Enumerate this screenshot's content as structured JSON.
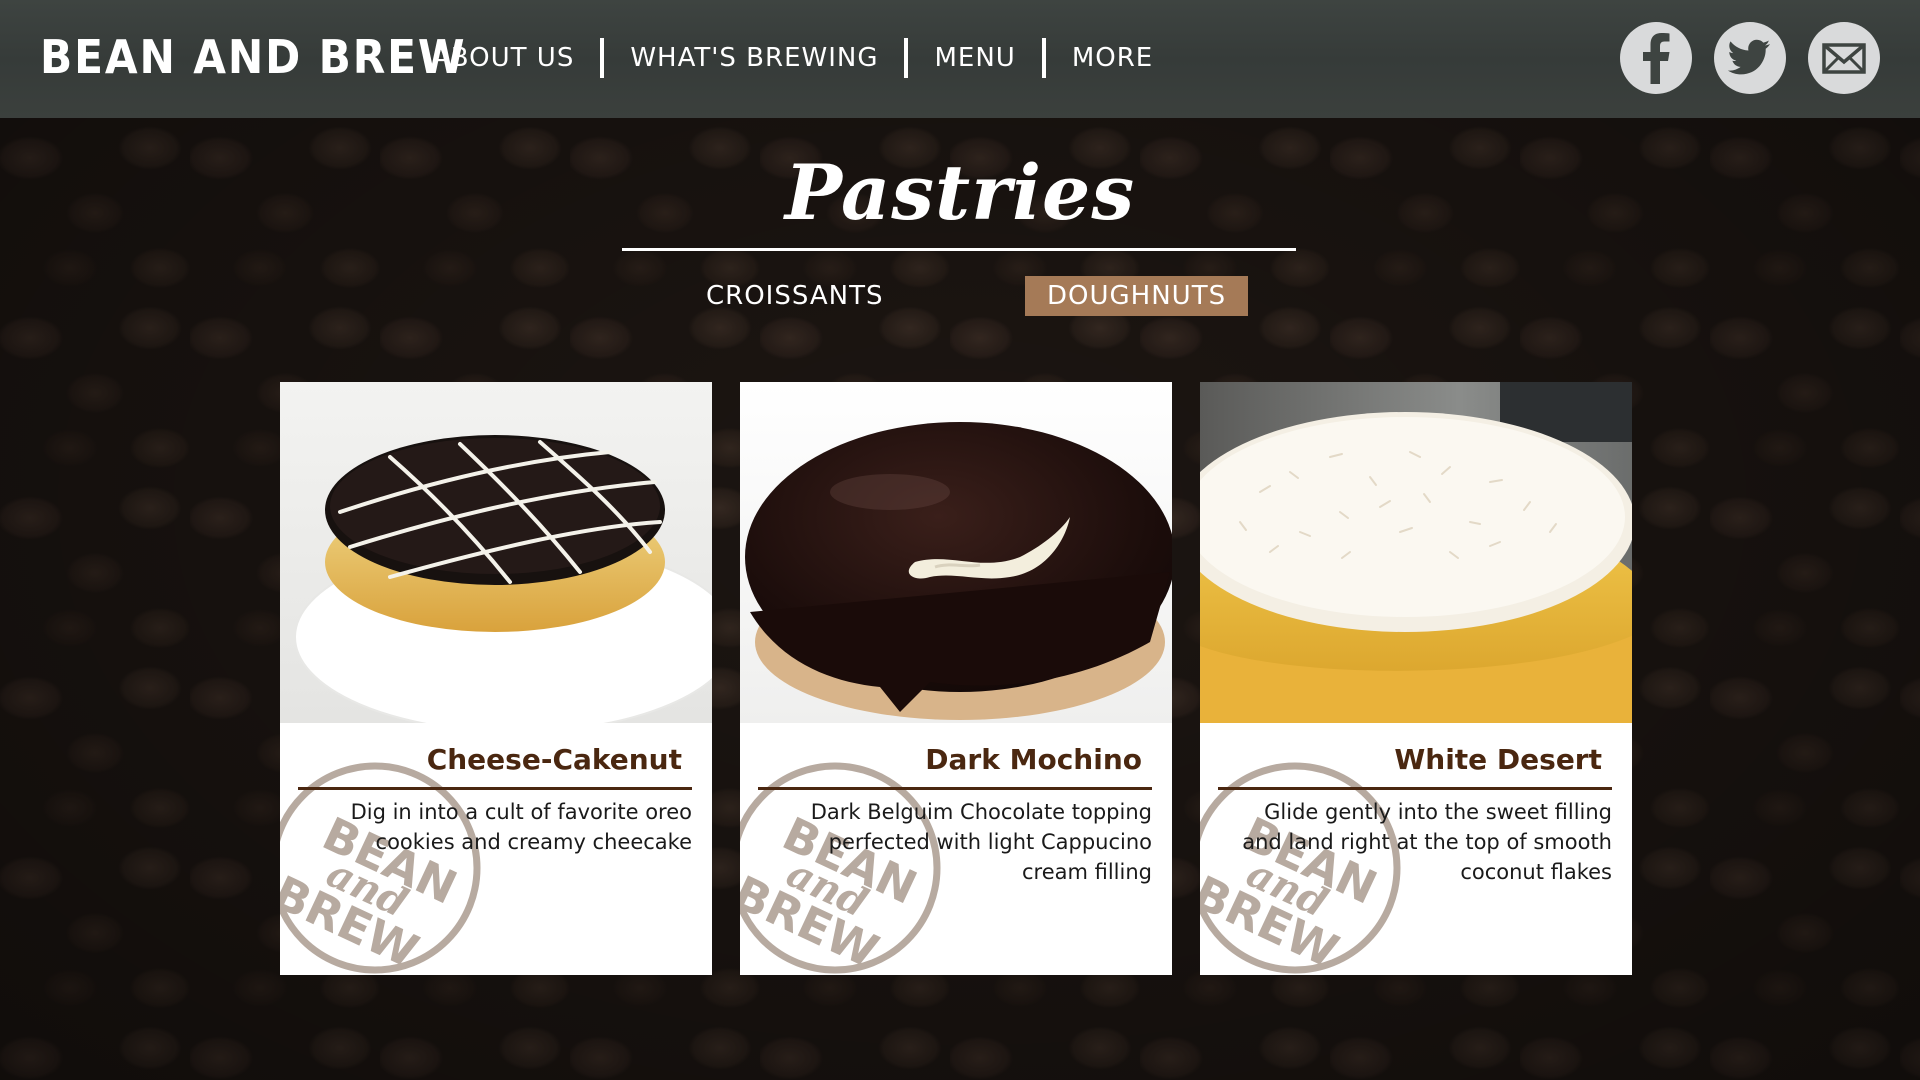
{
  "header": {
    "brand": "BEAN AND BREW",
    "nav": [
      "ABOUT US",
      "WHAT'S BREWING",
      "MENU",
      "MORE"
    ],
    "socials": [
      "facebook-icon",
      "twitter-icon",
      "mail-icon"
    ]
  },
  "page": {
    "title": "Pastries",
    "tabs": [
      {
        "label": "CROISSANTS",
        "active": false
      },
      {
        "label": "DOUGHNUTS",
        "active": true
      }
    ]
  },
  "stamp": {
    "line1": "BEAN",
    "line2": "and",
    "line3": "BREW"
  },
  "cards": [
    {
      "name": "Cheese-Cakenut",
      "description": "Dig in into a cult of favorite oreo cookies and creamy cheecake"
    },
    {
      "name": "Dark Mochino",
      "description": "Dark Belguim Chocolate topping perfected with light Cappucino cream filling"
    },
    {
      "name": "White Desert",
      "description": "Glide gently into the sweet filling and land right at the top of smooth coconut flakes"
    }
  ],
  "colors": {
    "header": "#3b403d",
    "active_tab": "#a57a57",
    "card_title": "#4a2710",
    "stamp": "#b7aaa0"
  }
}
